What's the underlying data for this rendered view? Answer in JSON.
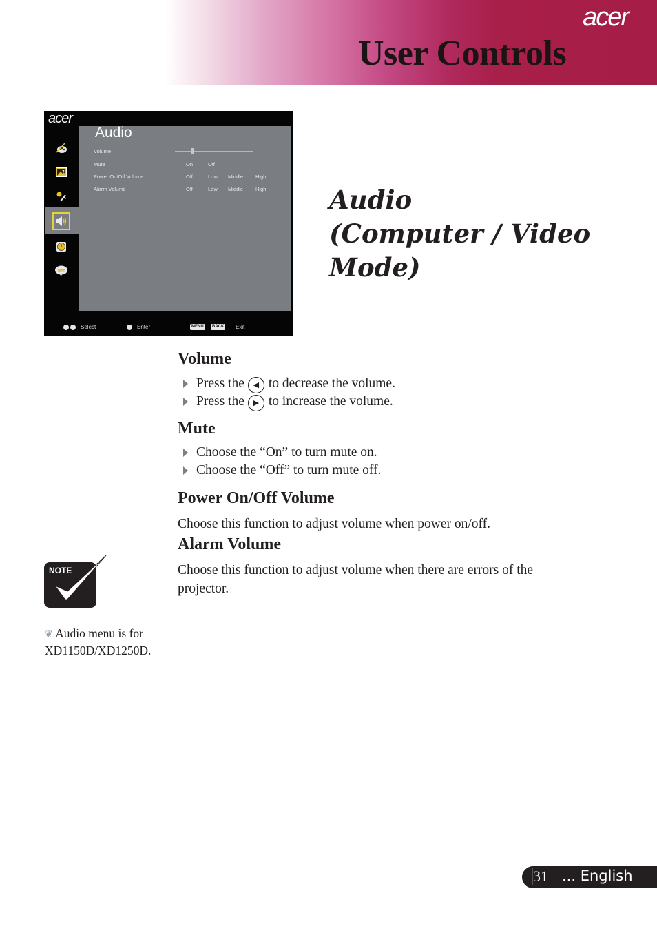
{
  "header": {
    "brand": "acer",
    "title": "User Controls",
    "gradient_colors": [
      "#ffffff",
      "#e3a9c9",
      "#c44a84",
      "#a61d47"
    ]
  },
  "osd": {
    "brand": "acer",
    "menu_title": "Audio",
    "sidebar_icons": [
      "color-palette-icon",
      "image-icon",
      "settings-tools-icon",
      "speaker-icon",
      "timer-icon",
      "language-icon"
    ],
    "active_icon": "speaker-icon",
    "rows": [
      {
        "label": "Volume",
        "type": "slider",
        "value_fraction": 0.22
      },
      {
        "label": "Mute",
        "options": [
          "On",
          "Off"
        ]
      },
      {
        "label": "Power On/Off Volume",
        "options": [
          "Off",
          "Low",
          "Middle",
          "High"
        ]
      },
      {
        "label": "Alarm Volume",
        "options": [
          "Off",
          "Low",
          "Middle",
          "High"
        ]
      }
    ],
    "footer": {
      "select_label": "Select",
      "enter_label": "Enter",
      "menu_key": "MENU",
      "back_key": "BACK",
      "exit_label": "Exit"
    }
  },
  "section_title": [
    "Audio",
    "(Computer / Video",
    "Mode)"
  ],
  "content": {
    "volume": {
      "heading": "Volume",
      "bullets": [
        {
          "before": "Press the",
          "button": "left-arrow",
          "after": "to decrease the volume."
        },
        {
          "before": "Press the",
          "button": "right-arrow",
          "after": "to increase the volume."
        }
      ]
    },
    "mute": {
      "heading": "Mute",
      "bullets": [
        "Choose the “On” to turn mute on.",
        "Choose the “Off” to turn mute off."
      ]
    },
    "power_volume": {
      "heading": "Power On/Off Volume",
      "text": "Choose this function to adjust volume when power on/off."
    },
    "alarm_volume": {
      "heading": "Alarm Volume",
      "text_line1": "Choose this function to adjust volume when there are errors of the",
      "text_line2": "projector."
    }
  },
  "note": {
    "icon_label": "NOTE",
    "line1": "Audio menu is for",
    "line2": "XD1150D/XD1250D."
  },
  "footer": {
    "page_number": "31",
    "language": "... English"
  }
}
